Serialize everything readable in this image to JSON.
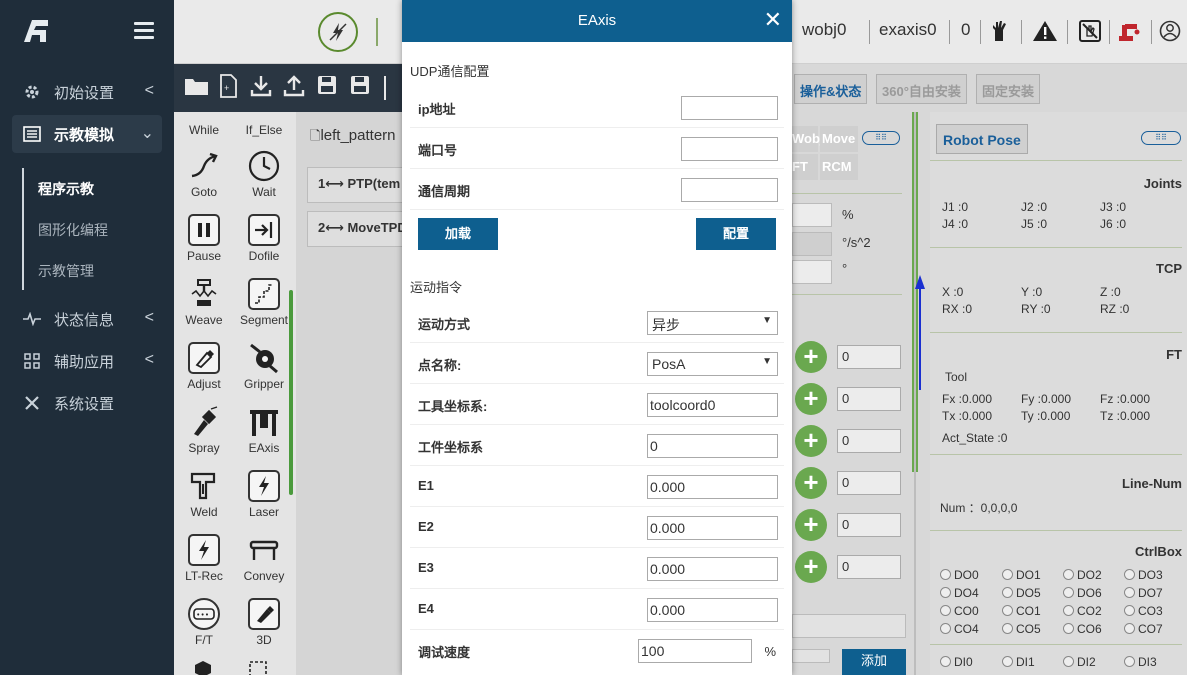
{
  "sidebar": {
    "items": [
      {
        "label": "初始设置",
        "icon": "gear-icon"
      },
      {
        "label": "示教模拟",
        "icon": "screen-icon"
      },
      {
        "label": "状态信息",
        "icon": "pulse-icon"
      },
      {
        "label": "辅助应用",
        "icon": "grid-icon"
      },
      {
        "label": "系统设置",
        "icon": "tools-icon"
      }
    ],
    "subitems": [
      "程序示教",
      "图形化编程",
      "示教管理"
    ]
  },
  "topbar": {
    "wobj": "wobj0",
    "exaxis": "exaxis0",
    "count": "0"
  },
  "tabs": [
    "操作&状态",
    "360°自由安装",
    "固定安装"
  ],
  "palette": [
    {
      "label": "While",
      "glyph": ""
    },
    {
      "label": "If_Else",
      "glyph": ""
    },
    {
      "label": "Goto",
      "glyph": "↗"
    },
    {
      "label": "Wait",
      "glyph": "◷"
    },
    {
      "label": "Pause",
      "glyph": "❚❚"
    },
    {
      "label": "Dofile",
      "glyph": "⇥"
    },
    {
      "label": "Weave",
      "glyph": "♜"
    },
    {
      "label": "Segment",
      "glyph": "⌐"
    },
    {
      "label": "Adjust",
      "glyph": "✎"
    },
    {
      "label": "Gripper",
      "glyph": "⚙"
    },
    {
      "label": "Spray",
      "glyph": "⚒"
    },
    {
      "label": "EAxis",
      "glyph": "╥"
    },
    {
      "label": "Weld",
      "glyph": "⌐"
    },
    {
      "label": "Laser",
      "glyph": "⚡"
    },
    {
      "label": "LT-Rec",
      "glyph": "⚡"
    },
    {
      "label": "Convey",
      "glyph": "⊓"
    },
    {
      "label": "F/T",
      "glyph": "⊞"
    },
    {
      "label": "3D",
      "glyph": "✎"
    }
  ],
  "program": {
    "filename": "left_pattern",
    "lines": [
      "1⟷ PTP(tem",
      "2⟷ MoveTPD"
    ]
  },
  "mid": {
    "tabs": [
      "Wobj",
      "Move",
      "FT",
      "RCM"
    ],
    "units": [
      "%",
      "°/s^2",
      "°"
    ],
    "values": [
      "0",
      "0",
      "0",
      "0",
      "0",
      "0"
    ],
    "add_label": "添加"
  },
  "robot_pose": {
    "title": "Robot Pose",
    "joints_title": "Joints",
    "joints": [
      "J1  :0",
      "J2  :0",
      "J3  :0",
      "J4  :0",
      "J5  :0",
      "J6  :0"
    ],
    "tcp_title": "TCP",
    "tcp": [
      "X   :0",
      "Y   :0",
      "Z   :0",
      "RX :0",
      "RY :0",
      "RZ :0"
    ],
    "ft_title": "FT",
    "tool_label": "Tool",
    "ft": [
      "Fx :0.000",
      "Fy :0.000",
      "Fz :0.000",
      "Tx :0.000",
      "Ty :0.000",
      "Tz :0.000"
    ],
    "act_state": "Act_State :0",
    "line_num_title": "Line-Num",
    "line_num": "Num  ：0,0,0,0",
    "ctrlbox_title": "CtrlBox",
    "ctrlbox": [
      "DO0",
      "DO1",
      "DO2",
      "DO3",
      "DO4",
      "DO5",
      "DO6",
      "DO7",
      "CO0",
      "CO1",
      "CO2",
      "CO3",
      "CO4",
      "CO5",
      "CO6",
      "CO7",
      "DI0",
      "DI1",
      "DI2",
      "DI3"
    ]
  },
  "dialog": {
    "title": "EAxis",
    "udp_section": "UDP通信配置",
    "udp_rows": [
      {
        "label": "ip地址",
        "value": ""
      },
      {
        "label": "端口号",
        "value": ""
      },
      {
        "label": "通信周期",
        "value": ""
      }
    ],
    "load_button": "加载",
    "config_button": "配置",
    "motion_section": "运动指令",
    "motion_mode_label": "运动方式",
    "motion_mode_value": "异步",
    "point_label": "点名称:",
    "point_value": "PosA",
    "tool_label": "工具坐标系:",
    "tool_value": "toolcoord0",
    "wobj_label": "工件坐标系",
    "wobj_value": "0",
    "axes": [
      {
        "label": "E1",
        "value": "0.000"
      },
      {
        "label": "E2",
        "value": "0.000"
      },
      {
        "label": "E3",
        "value": "0.000"
      },
      {
        "label": "E4",
        "value": "0.000"
      }
    ],
    "speed_label": "调试速度",
    "speed_value": "100",
    "speed_unit": "%"
  },
  "colors": {
    "sidebar": "#1f2d3a",
    "dialog_header": "#0e5f8f",
    "accent_green": "#6aa84f"
  }
}
